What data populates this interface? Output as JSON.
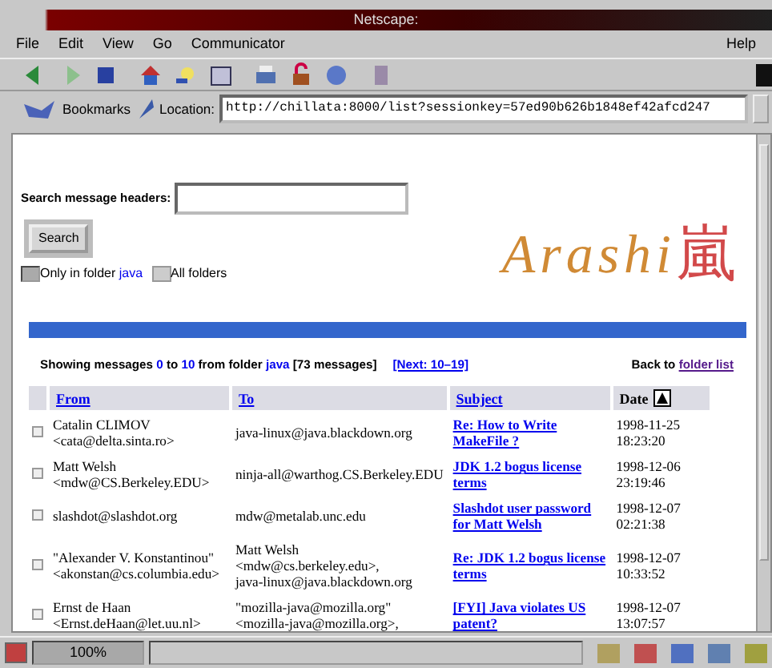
{
  "window": {
    "title": "Netscape:"
  },
  "menu": [
    {
      "label": "File"
    },
    {
      "label": "Edit"
    },
    {
      "label": "View"
    },
    {
      "label": "Go"
    },
    {
      "label": "Communicator"
    },
    {
      "label": "Help",
      "kind": "right"
    }
  ],
  "location_bar": {
    "bookmarks": "Bookmarks",
    "label": "Location:",
    "url": "http://chillata:8000/list?sessionkey=57ed90b626b1848ef42afcd247"
  },
  "search": {
    "label": "Search message headers:",
    "button": "Search",
    "options": [
      {
        "label": "Only in folder ",
        "link": "java",
        "selected": true
      },
      {
        "label": "All folders",
        "selected": false
      }
    ]
  },
  "logo": {
    "text": "Arashi",
    "kanji": "嵐"
  },
  "summary": [
    {
      "kind": "plain",
      "text": "Showing messages "
    },
    {
      "kind": "link",
      "text": "0"
    },
    {
      "kind": "plain",
      "text": " to "
    },
    {
      "kind": "link",
      "text": "10"
    },
    {
      "kind": "plain",
      "text": " from folder "
    },
    {
      "kind": "link",
      "text": "java"
    },
    {
      "kind": "plain",
      "text": " [73 messages]"
    }
  ],
  "next_link": "[Next: 10–19]",
  "back": {
    "label": "Back to",
    "link": "folder list"
  },
  "table": {
    "columns": [
      {
        "label": "From",
        "kind": "link"
      },
      {
        "label": "To",
        "kind": "link"
      },
      {
        "label": "Subject",
        "kind": "link"
      },
      {
        "label": "Date",
        "kind": "sorted"
      }
    ],
    "rows": [
      {
        "checked": false,
        "from": "Catalin CLIMOV\n<cata@delta.sinta.ro>",
        "to": "java-linux@java.blackdown.org",
        "subject": "Re: How to Write MakeFile ?",
        "date": "1998-11-25\n18:23:20"
      },
      {
        "checked": false,
        "from": "Matt Welsh\n<mdw@CS.Berkeley.EDU>",
        "to": "ninja-all@warthog.CS.Berkeley.EDU",
        "subject": "JDK 1.2 bogus license terms",
        "date": "1998-12-06\n23:19:46"
      },
      {
        "checked": false,
        "from": "slashdot@slashdot.org",
        "to": "mdw@metalab.unc.edu",
        "subject": "Slashdot user password for Matt Welsh",
        "date": "1998-12-07\n02:21:38"
      },
      {
        "checked": false,
        "from": "\"Alexander V. Konstantinou\"\n<akonstan@cs.columbia.edu>",
        "to": "Matt Welsh\n<mdw@cs.berkeley.edu>,\njava-linux@java.blackdown.org",
        "subject": "Re: JDK 1.2 bogus license terms",
        "date": "1998-12-07\n10:33:52"
      },
      {
        "checked": false,
        "from": "Ernst de Haan\n<Ernst.deHaan@let.uu.nl>",
        "to": "\"mozilla-java@mozilla.org\"\n<mozilla-java@mozilla.org>,",
        "subject": "[FYI] Java violates US patent?",
        "date": "1998-12-07\n13:07:57"
      }
    ]
  },
  "status_bar": {
    "zoom": "100%"
  }
}
